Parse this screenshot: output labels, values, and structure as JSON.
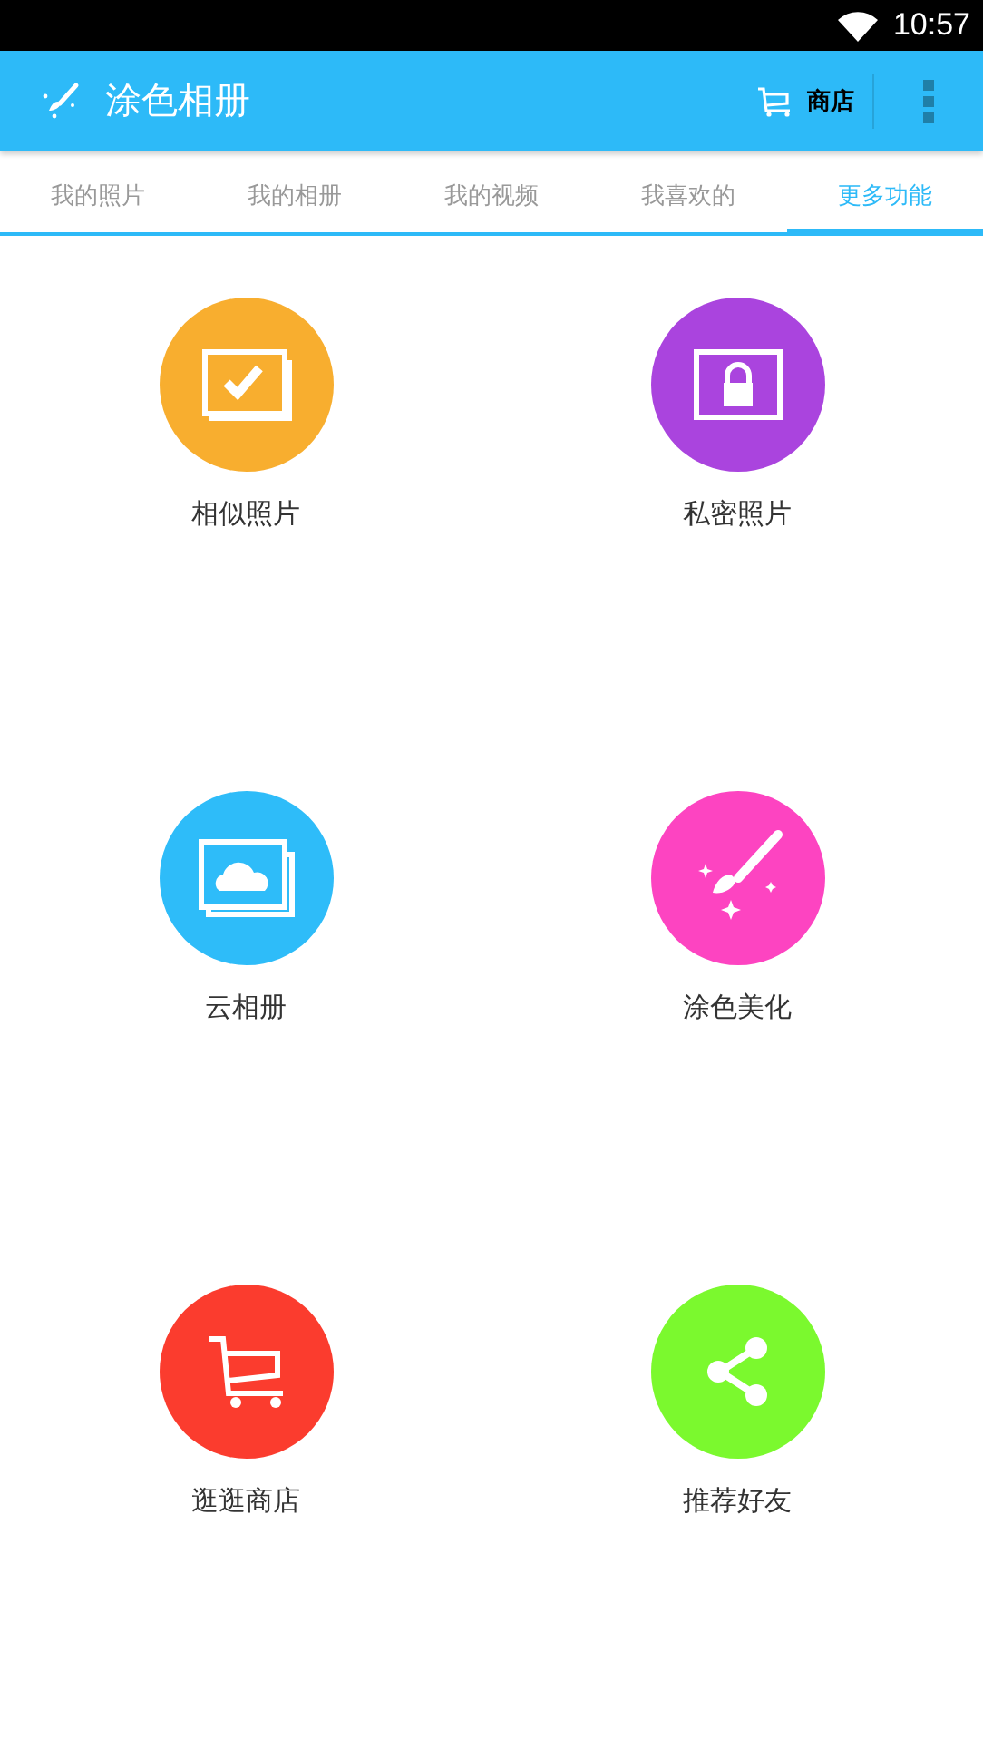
{
  "status_bar": {
    "time": "10:57"
  },
  "app_bar": {
    "title": "涂色相册",
    "store_label": "商店"
  },
  "tabs": [
    {
      "label": "我的照片",
      "selected": false
    },
    {
      "label": "我的相册",
      "selected": false
    },
    {
      "label": "我的视频",
      "selected": false
    },
    {
      "label": "我喜欢的",
      "selected": false
    },
    {
      "label": "更多功能",
      "selected": true
    }
  ],
  "features": [
    {
      "label": "相似照片",
      "kind": "similar",
      "color": "#f8ae2f"
    },
    {
      "label": "私密照片",
      "kind": "private",
      "color": "#aa44de"
    },
    {
      "label": "云相册",
      "kind": "cloud",
      "color": "#2ebcf9"
    },
    {
      "label": "涂色美化",
      "kind": "brush",
      "color": "#fd44c1"
    },
    {
      "label": "逛逛商店",
      "kind": "cart",
      "color": "#fb3c2e"
    },
    {
      "label": "推荐好友",
      "kind": "share",
      "color": "#7bf92e"
    }
  ]
}
